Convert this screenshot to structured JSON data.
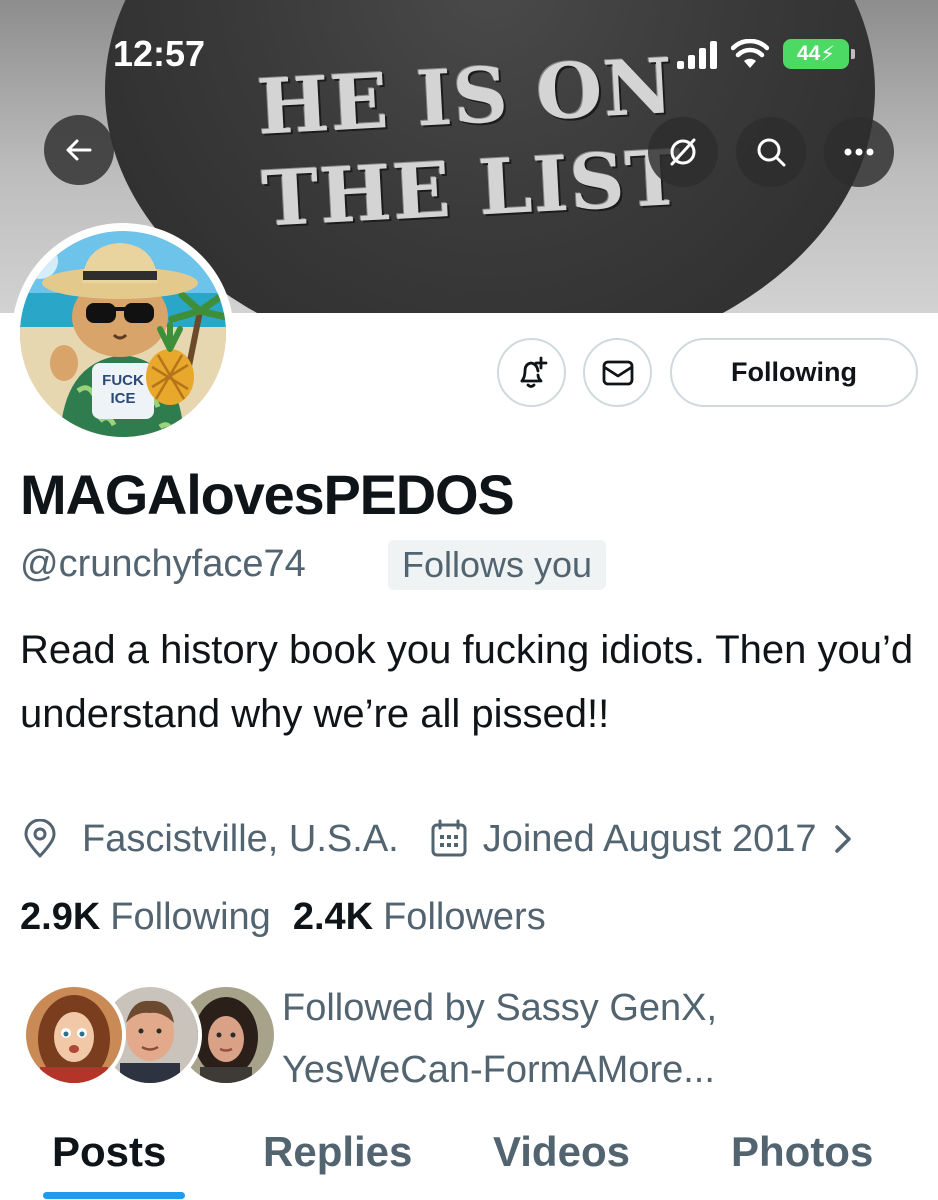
{
  "status_bar": {
    "time": "12:57",
    "battery": "44"
  },
  "banner": {
    "text_line1": "HE IS ON",
    "text_line2": "THE LIST"
  },
  "nav": {
    "back_icon": "arrow-left-icon",
    "grok_icon": "grok-icon",
    "search_icon": "search-icon",
    "more_icon": "more-horizontal-icon"
  },
  "avatar": {
    "badge_text_line1": "FUCK",
    "badge_text_line2": "ICE"
  },
  "actions": {
    "notify_icon": "bell-plus-icon",
    "message_icon": "envelope-icon",
    "following_label": "Following"
  },
  "profile": {
    "display_name": "MAGAlovesPEDOS",
    "handle": "@crunchyface74",
    "follows_you": "Follows you",
    "bio": "Read a history book you fucking idiots. Then you’d understand why we’re all pissed!!",
    "location": "Fascistville, U.S.A.",
    "joined": "Joined August 2017",
    "following_count": "2.9K",
    "following_label": "Following",
    "followers_count": "2.4K",
    "followers_label": "Followers",
    "followed_by": "Followed by Sassy GenX, YesWeCan-FormAMore..."
  },
  "tabs": [
    {
      "label": "Posts",
      "active": true
    },
    {
      "label": "Replies",
      "active": false
    },
    {
      "label": "Videos",
      "active": false
    },
    {
      "label": "Photos",
      "active": false
    }
  ],
  "colors": {
    "accent": "#1d9bf0",
    "text": "#0f1419",
    "muted": "#536471",
    "border": "#cfd9de",
    "battery": "#4cd964"
  }
}
